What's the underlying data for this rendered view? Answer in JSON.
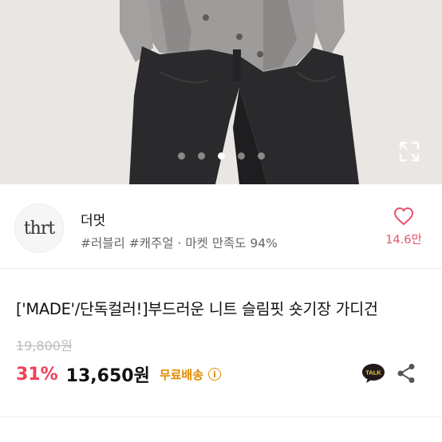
{
  "gallery": {
    "slides": 5,
    "active_slide": 3,
    "expand_icon": "expand-icon"
  },
  "shop": {
    "logo_text": "thrt",
    "name": "더멋",
    "tags": "#러블리 #캐주얼 · 마켓 만족도 94%",
    "like_icon": "heart-icon",
    "like_count": "14.6만"
  },
  "product": {
    "title": "['MADE'/단독컬러!]부드러운 니트 슬림핏 숏기장 가디건",
    "original_price": "19,800원",
    "discount": "31%",
    "price": "13,650원",
    "shipping": "무료배송",
    "info_icon": "i"
  },
  "actions": {
    "talk_label": "TALK",
    "share_icon": "share-icon"
  },
  "colors": {
    "discount": "#f23f58",
    "shipping": "#e08a00",
    "like": "#e8516d",
    "talk_bg": "#231b1b"
  }
}
